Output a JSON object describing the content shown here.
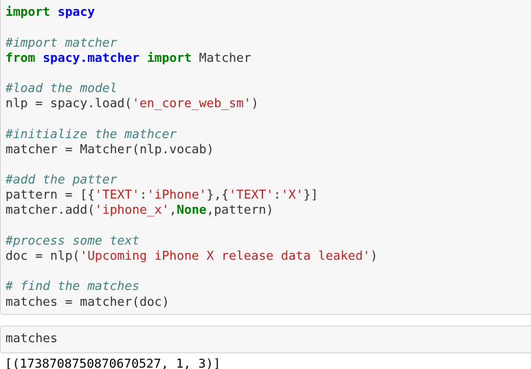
{
  "code_cell": {
    "import_kw": "import",
    "spacy_mod": "spacy",
    "comment_import": "#import matcher",
    "from_kw": "from",
    "matcher_mod": "spacy.matcher",
    "import_kw2": "import",
    "matcher_class": " Matcher",
    "comment_load": "#load the model",
    "nlp_assign": "nlp = spacy.load(",
    "model_str": "'en_core_web_sm'",
    "close_paren": ")",
    "comment_init": "#initialize the mathcer",
    "matcher_assign": "matcher = Matcher(nlp.vocab)",
    "comment_patter": "#add the patter",
    "pattern_prefix": "pattern = [{",
    "text_key1": "'TEXT'",
    "colon1": ":",
    "iphone_str": "'iPhone'",
    "mid_sep": "},{",
    "text_key2": "'TEXT'",
    "colon2": ":",
    "x_str": "'X'",
    "pattern_suffix": "}]",
    "add_prefix": "matcher.add(",
    "label_str": "'iphone_x'",
    "comma1": ",",
    "none_kw": "None",
    "add_suffix": ",pattern)",
    "comment_process": "#process some text",
    "doc_assign": "doc = nlp(",
    "text_str": "'Upcoming iPhone X release data leaked'",
    "doc_close": ")",
    "comment_find": "# find the matches",
    "matches_assign": "matches = matcher(doc)"
  },
  "matches_cell": {
    "input": "matches"
  },
  "output": {
    "text": "[(1738708750870670527, 1, 3)]"
  }
}
